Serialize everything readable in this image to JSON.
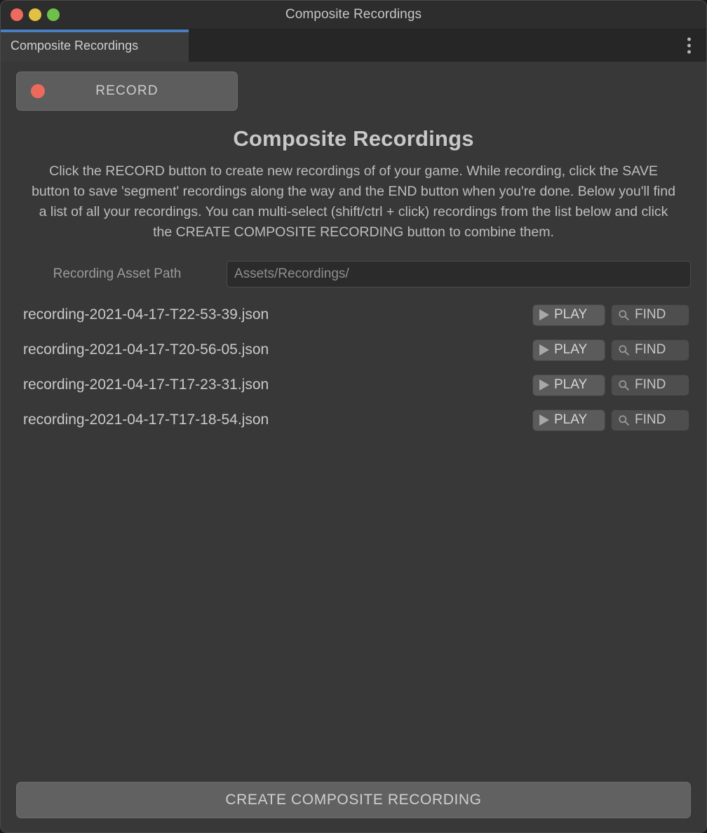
{
  "window": {
    "title": "Composite Recordings",
    "traffic_lights": [
      {
        "name": "close",
        "color": "#ed6a5e"
      },
      {
        "name": "minimize",
        "color": "#e2c044"
      },
      {
        "name": "maximize",
        "color": "#6fc04a"
      }
    ]
  },
  "tabstrip": {
    "active_tab": "Composite Recordings",
    "accent_color": "#4a7fc1",
    "menu_icon": "kebab-menu-icon"
  },
  "toolbar": {
    "record_label": "RECORD",
    "record_dot_color": "#ec6a5c"
  },
  "main": {
    "heading": "Composite Recordings",
    "description": "Click the RECORD button to create new recordings of of your game.  While recording, click the SAVE button to save 'segment' recordings along the way and the END button when you're done.  Below you'll find a list of all your recordings. You can multi-select (shift/ctrl + click) recordings from the list below and click the CREATE COMPOSITE RECORDING button to combine them."
  },
  "asset_path": {
    "label": "Recording Asset Path",
    "value": "",
    "placeholder": "Assets/Recordings/"
  },
  "recordings": {
    "play_label": "PLAY",
    "find_label": "FIND",
    "play_icon": "play-triangle-icon",
    "find_icon": "magnifier-icon",
    "items": [
      {
        "name": "recording-2021-04-17-T22-53-39.json"
      },
      {
        "name": "recording-2021-04-17-T20-56-05.json"
      },
      {
        "name": "recording-2021-04-17-T17-23-31.json"
      },
      {
        "name": "recording-2021-04-17-T17-18-54.json"
      }
    ]
  },
  "footer": {
    "composite_label": "CREATE COMPOSITE RECORDING"
  }
}
